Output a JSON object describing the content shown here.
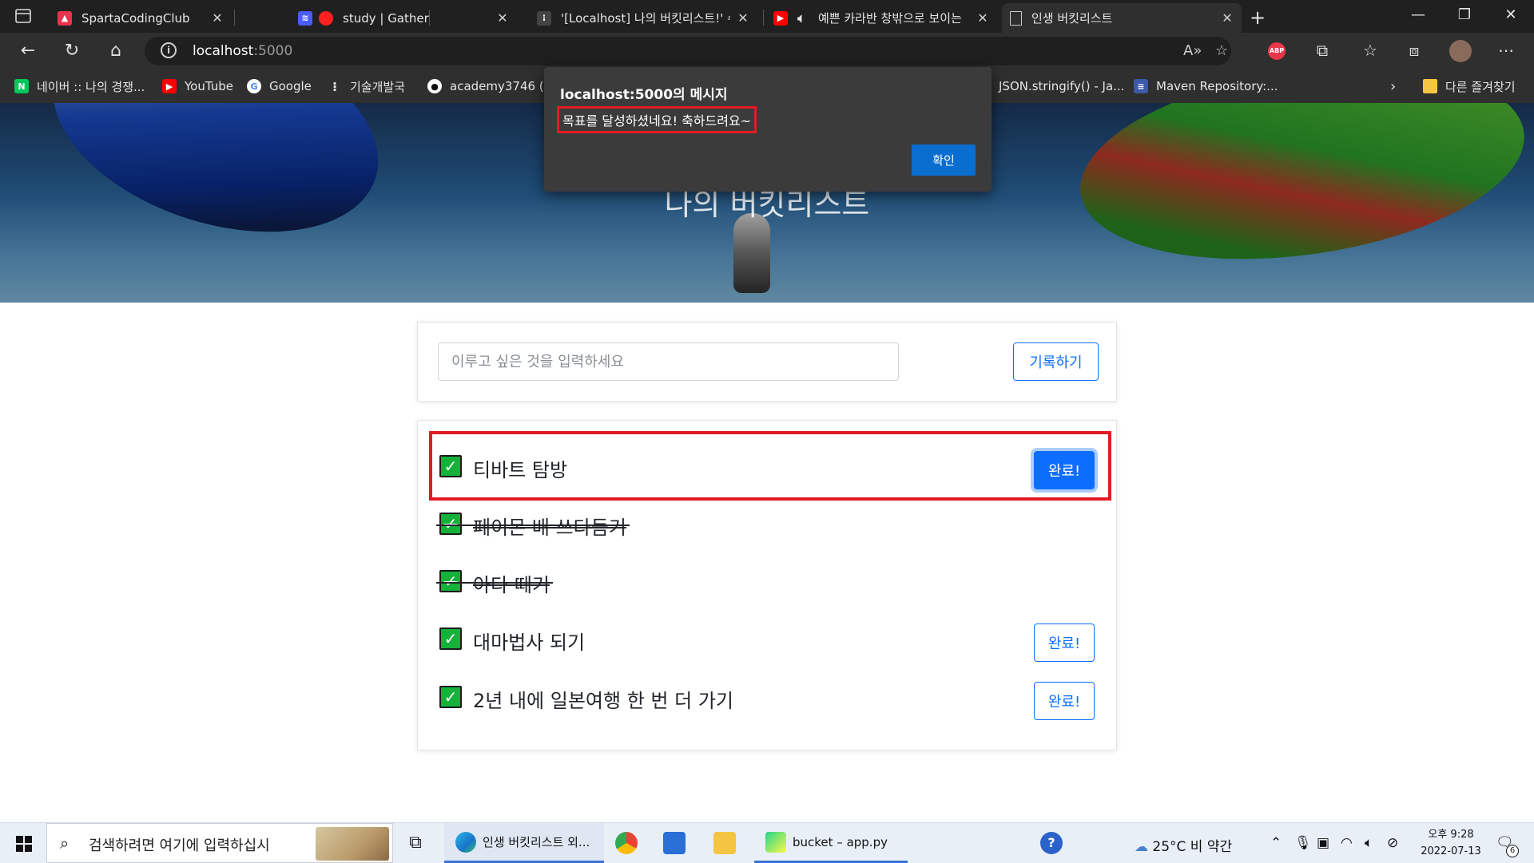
{
  "browser": {
    "tabs": [
      {
        "title": "SpartaCodingClub",
        "favicon": "sparta-favicon",
        "color": "#e8344e"
      },
      {
        "title": "study | Gather",
        "favicon": "gather-favicon",
        "color": "#4a5cf5"
      },
      {
        "title": "'[Localhost] 나의 버킷리스트!' 수",
        "favicon": "figma-favicon",
        "color": "#444444"
      },
      {
        "title": "예쁜 카라반 창밖으로 보이는",
        "favicon": "youtube-favicon",
        "color": "#ff0000"
      },
      {
        "title": "인생 버킷리스트",
        "favicon": "page-favicon",
        "color": "#cccccc"
      }
    ],
    "address": {
      "host": "localhost",
      "port": ":5000"
    },
    "bookmarks": [
      {
        "label": "네이버 :: 나의 경쟁...",
        "icon": "naver-icon",
        "color": "#03c75a",
        "glyph": "N"
      },
      {
        "label": "YouTube",
        "icon": "youtube-icon",
        "color": "#ff0000",
        "glyph": "▶"
      },
      {
        "label": "Google",
        "icon": "google-icon",
        "color": "#4285f4",
        "glyph": "G"
      },
      {
        "label": "기술개발국",
        "icon": "dots-icon",
        "color": "#2f2f2f",
        "glyph": "⁝"
      },
      {
        "label": "academy3746 (Co",
        "icon": "github-icon",
        "color": "#2f2f2f",
        "glyph": "●"
      },
      {
        "label": "JSON.stringify() - Ja...",
        "icon": "mdn-icon",
        "color": "#2f2f2f",
        "glyph": "M"
      },
      {
        "label": "Maven Repository:...",
        "icon": "maven-icon",
        "color": "#3d5aa8",
        "glyph": "≡"
      },
      {
        "label": "다른 즐겨찾기",
        "icon": "folder-icon",
        "color": "#f4c542",
        "glyph": ""
      }
    ]
  },
  "hero": {
    "title": "나의 버킷리스트"
  },
  "dialog": {
    "title": "localhost:5000의 메시지",
    "message": "목표를 달성하셨네요! 축하드려요~",
    "ok_label": "확인"
  },
  "input": {
    "placeholder": "이루고 싶은 것을 입력하세요",
    "button_label": "기록하기"
  },
  "bucket_list": [
    {
      "text": "티바트 탐방",
      "done": false,
      "button_label": "완료!",
      "button_state": "focused"
    },
    {
      "text": "페이몬 배 쓰다듬기",
      "done": true
    },
    {
      "text": "아다 떼기",
      "done": true
    },
    {
      "text": "대마법사 되기",
      "done": false,
      "button_label": "완료!"
    },
    {
      "text": "2년 내에 일본여행 한 번 더 가기",
      "done": false,
      "button_label": "완료!"
    }
  ],
  "taskbar": {
    "search_placeholder": "검색하려면 여기에 입력하십시",
    "apps": [
      {
        "label": "인생 버킷리스트 외...",
        "icon": "edge-icon",
        "state": "active"
      },
      {
        "label": "bucket – app.py",
        "icon": "pycharm-icon",
        "state": "open"
      }
    ],
    "weather": "25°C  비 약간",
    "time": "오후 9:28",
    "date": "2022-07-13",
    "notification_count": "6"
  },
  "colors": {
    "accent": "#0d6efd",
    "highlight_box": "#e31b23",
    "check": "#16b13a",
    "dialog_bg": "#3b3b3b"
  }
}
